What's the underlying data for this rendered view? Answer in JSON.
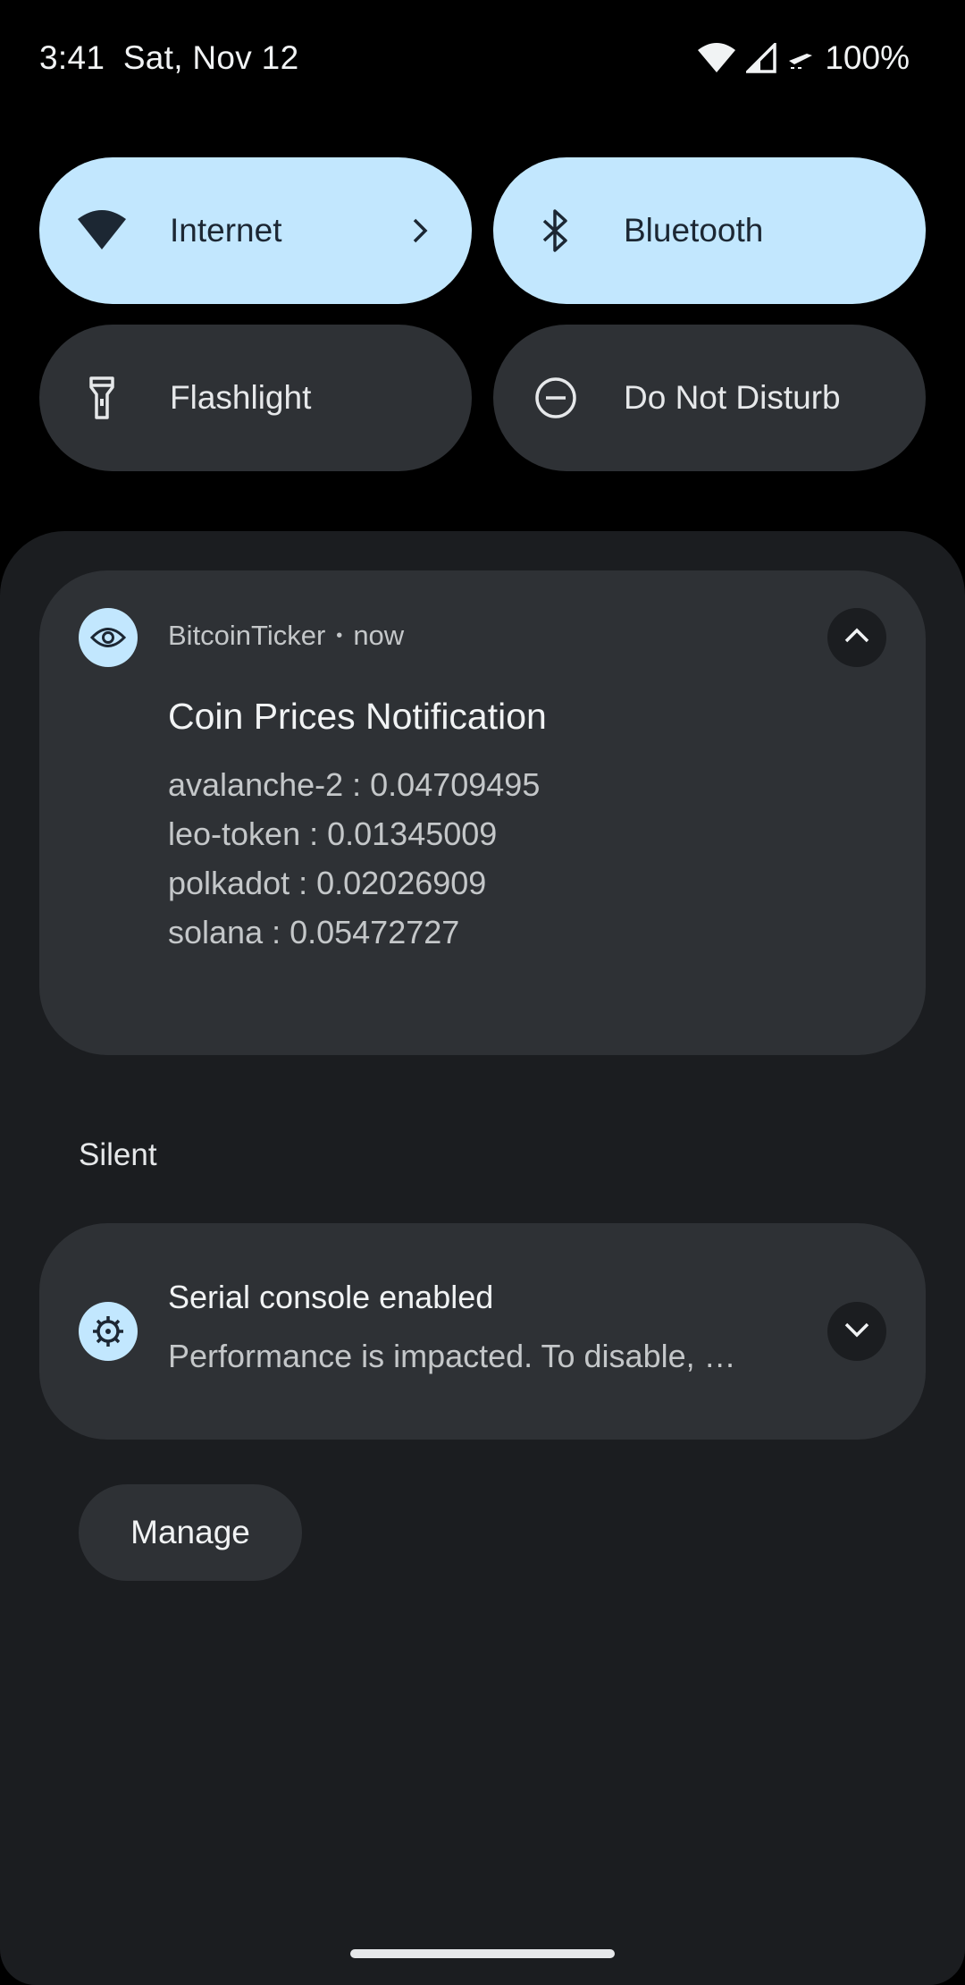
{
  "status_bar": {
    "time": "3:41",
    "date": "Sat, Nov 12",
    "battery": "100%"
  },
  "quick_tiles": [
    {
      "label": "Internet",
      "icon": "wifi-icon",
      "state": "on",
      "has_chevron": true
    },
    {
      "label": "Bluetooth",
      "icon": "bluetooth-icon",
      "state": "on"
    },
    {
      "label": "Flashlight",
      "icon": "flashlight-icon",
      "state": "off"
    },
    {
      "label": "Do Not Disturb",
      "icon": "do-not-disturb-icon",
      "state": "off"
    }
  ],
  "notifications": {
    "coin": {
      "app_name": "BitcoinTicker",
      "time": "now",
      "app_icon": "eye-icon",
      "title": "Coin Prices Notification",
      "lines": [
        "avalanche-2 : 0.04709495",
        "leo-token : 0.01345009",
        "polkadot : 0.02026909",
        "solana : 0.05472727"
      ],
      "expanded": true
    },
    "silent_section_label": "Silent",
    "serial": {
      "app_icon": "bug-icon",
      "title": "Serial console enabled",
      "text": "Performance is impacted. To disable, …",
      "expanded": false
    }
  },
  "manage_label": "Manage",
  "colors": {
    "tile_on": "#c2e7fe",
    "tile_off": "#2e3135",
    "shade_bg": "#1b1d20",
    "card_bg": "#2e3135"
  }
}
